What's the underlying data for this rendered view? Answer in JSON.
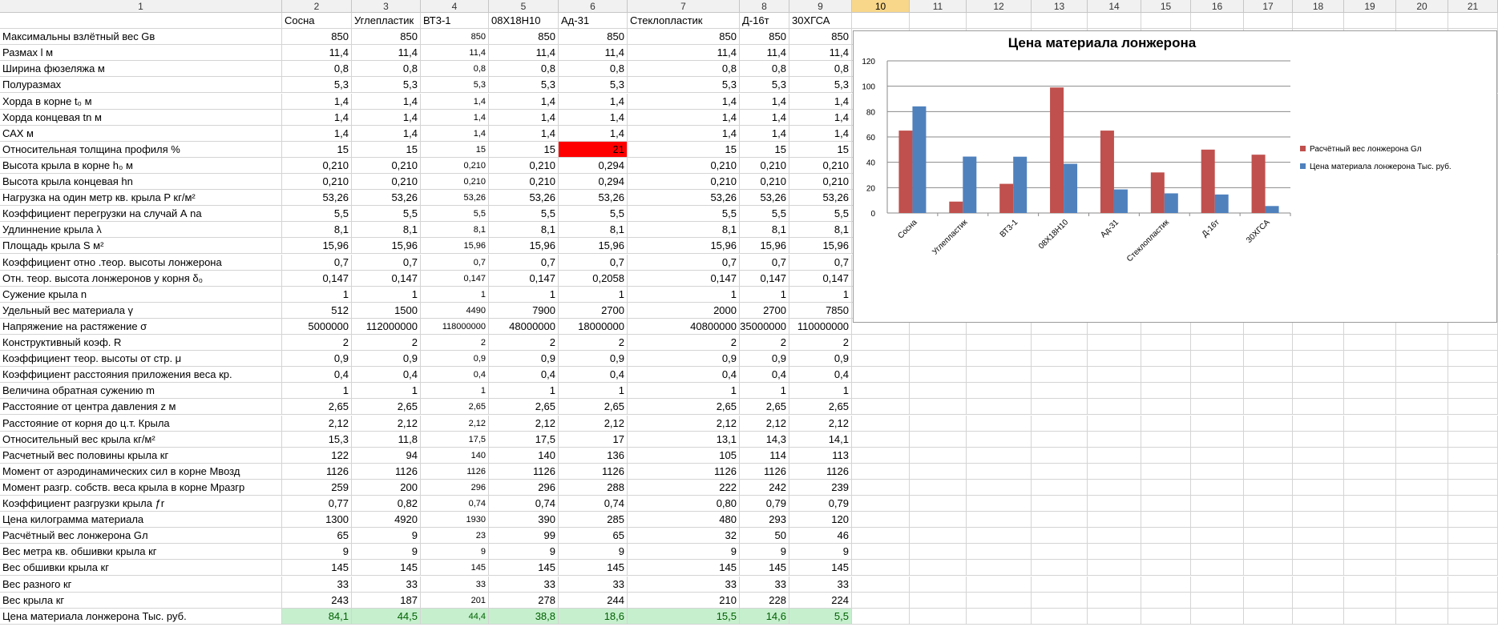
{
  "sheet": {
    "column_headers": [
      "1",
      "2",
      "3",
      "4",
      "5",
      "6",
      "7",
      "8",
      "9",
      "10",
      "11",
      "12",
      "13",
      "14",
      "15",
      "16",
      "17",
      "18",
      "19",
      "20",
      "21"
    ],
    "active_column": "10",
    "materials": [
      "Сосна",
      "Углепластик",
      "ВТ3-1",
      "08Х18Н10",
      "Ад-31",
      "Стеклопластик",
      "Д-16т",
      "30ХГСА"
    ],
    "rows": [
      {
        "label": "Максимальны взлётный вес Gв",
        "values": [
          "850",
          "850",
          "850",
          "850",
          "850",
          "850",
          "850",
          "850"
        ]
      },
      {
        "label": "Размах l м",
        "values": [
          "11,4",
          "11,4",
          "11,4",
          "11,4",
          "11,4",
          "11,4",
          "11,4",
          "11,4"
        ]
      },
      {
        "label": "Ширина фюзеляжа м",
        "values": [
          "0,8",
          "0,8",
          "0,8",
          "0,8",
          "0,8",
          "0,8",
          "0,8",
          "0,8"
        ]
      },
      {
        "label": "Полуразмах",
        "values": [
          "5,3",
          "5,3",
          "5,3",
          "5,3",
          "5,3",
          "5,3",
          "5,3",
          "5,3"
        ]
      },
      {
        "label": "Хорда в корне t₀ м",
        "values": [
          "1,4",
          "1,4",
          "1,4",
          "1,4",
          "1,4",
          "1,4",
          "1,4",
          "1,4"
        ]
      },
      {
        "label": "Хорда концевая tn м",
        "values": [
          "1,4",
          "1,4",
          "1,4",
          "1,4",
          "1,4",
          "1,4",
          "1,4",
          "1,4"
        ]
      },
      {
        "label": "САХ м",
        "values": [
          "1,4",
          "1,4",
          "1,4",
          "1,4",
          "1,4",
          "1,4",
          "1,4",
          "1,4"
        ]
      },
      {
        "label": "Относительная толщина профиля %",
        "values": [
          "15",
          "15",
          "15",
          "15",
          "21",
          "15",
          "15",
          "15"
        ]
      },
      {
        "label": "Высота крыла в корне h₀ м",
        "values": [
          "0,210",
          "0,210",
          "0,210",
          "0,210",
          "0,294",
          "0,210",
          "0,210",
          "0,210"
        ]
      },
      {
        "label": "Высота крыла концевая hn",
        "values": [
          "0,210",
          "0,210",
          "0,210",
          "0,210",
          "0,294",
          "0,210",
          "0,210",
          "0,210"
        ]
      },
      {
        "label": "Нагрузка на один метр кв. крыла P кг/м²",
        "values": [
          "53,26",
          "53,26",
          "53,26",
          "53,26",
          "53,26",
          "53,26",
          "53,26",
          "53,26"
        ]
      },
      {
        "label": "Коэффициент перегрузки на случай А nа",
        "values": [
          "5,5",
          "5,5",
          "5,5",
          "5,5",
          "5,5",
          "5,5",
          "5,5",
          "5,5"
        ]
      },
      {
        "label": "Удлиннение крыла λ",
        "values": [
          "8,1",
          "8,1",
          "8,1",
          "8,1",
          "8,1",
          "8,1",
          "8,1",
          "8,1"
        ]
      },
      {
        "label": "Площадь крыла S м²",
        "values": [
          "15,96",
          "15,96",
          "15,96",
          "15,96",
          "15,96",
          "15,96",
          "15,96",
          "15,96"
        ]
      },
      {
        "label": "Коэффициент отно .теор. высоты лонжерона",
        "values": [
          "0,7",
          "0,7",
          "0,7",
          "0,7",
          "0,7",
          "0,7",
          "0,7",
          "0,7"
        ]
      },
      {
        "label": "Отн. теор. высота лонжеронов у корня δ₀",
        "values": [
          "0,147",
          "0,147",
          "0,147",
          "0,147",
          "0,2058",
          "0,147",
          "0,147",
          "0,147"
        ]
      },
      {
        "label": "Сужение крыла n",
        "values": [
          "1",
          "1",
          "1",
          "1",
          "1",
          "1",
          "1",
          "1"
        ]
      },
      {
        "label": "Удельный вес материала γ",
        "values": [
          "512",
          "1500",
          "4490",
          "7900",
          "2700",
          "2000",
          "2700",
          "7850"
        ]
      },
      {
        "label": "Напряжение на растяжение σ",
        "values": [
          "5000000",
          "112000000",
          "118000000",
          "48000000",
          "18000000",
          "40800000",
          "35000000",
          "110000000"
        ]
      },
      {
        "label": "Конструктивный коэф. R",
        "values": [
          "2",
          "2",
          "2",
          "2",
          "2",
          "2",
          "2",
          "2"
        ]
      },
      {
        "label": "Коэффициент теор.  высоты  от стр. μ",
        "values": [
          "0,9",
          "0,9",
          "0,9",
          "0,9",
          "0,9",
          "0,9",
          "0,9",
          "0,9"
        ]
      },
      {
        "label": "Коэффициент расстояния приложения веса кр.",
        "values": [
          "0,4",
          "0,4",
          "0,4",
          "0,4",
          "0,4",
          "0,4",
          "0,4",
          "0,4"
        ]
      },
      {
        "label": "Величина обратная сужению m",
        "values": [
          "1",
          "1",
          "1",
          "1",
          "1",
          "1",
          "1",
          "1"
        ]
      },
      {
        "label": "Расстояние от центра давления z м",
        "values": [
          "2,65",
          "2,65",
          "2,65",
          "2,65",
          "2,65",
          "2,65",
          "2,65",
          "2,65"
        ]
      },
      {
        "label": "Расстояние от корня до ц.т. Крыла",
        "values": [
          "2,12",
          "2,12",
          "2,12",
          "2,12",
          "2,12",
          "2,12",
          "2,12",
          "2,12"
        ]
      },
      {
        "label": "Относительный вес крыла кг/м²",
        "values": [
          "15,3",
          "11,8",
          "17,5",
          "17,5",
          "17",
          "13,1",
          "14,3",
          "14,1"
        ]
      },
      {
        "label": "Расчетный вес половины крыла кг",
        "values": [
          "122",
          "94",
          "140",
          "140",
          "136",
          "105",
          "114",
          "113"
        ]
      },
      {
        "label": "Момент от аэродинамических сил в корне Mвозд",
        "values": [
          "1126",
          "1126",
          "1126",
          "1126",
          "1126",
          "1126",
          "1126",
          "1126"
        ]
      },
      {
        "label": "Момент разгр. собств. веса крыла в корне Mразгр",
        "values": [
          "259",
          "200",
          "296",
          "296",
          "288",
          "222",
          "242",
          "239"
        ]
      },
      {
        "label": "Коэффициент разгрузки крыла ƒr",
        "values": [
          "0,77",
          "0,82",
          "0,74",
          "0,74",
          "0,74",
          "0,80",
          "0,79",
          "0,79"
        ]
      },
      {
        "label": "Цена килограмма материала",
        "values": [
          "1300",
          "4920",
          "1930",
          "390",
          "285",
          "480",
          "293",
          "120"
        ]
      },
      {
        "label": "Расчётный вес лонжерона Gл",
        "values": [
          "65",
          "9",
          "23",
          "99",
          "65",
          "32",
          "50",
          "46"
        ]
      },
      {
        "label": "Вес метра кв. обшивки крыла кг",
        "values": [
          "9",
          "9",
          "9",
          "9",
          "9",
          "9",
          "9",
          "9"
        ]
      },
      {
        "label": "Вес обшивки крыла кг",
        "values": [
          "145",
          "145",
          "145",
          "145",
          "145",
          "145",
          "145",
          "145"
        ]
      },
      {
        "label": "Вес разного кг",
        "values": [
          "33",
          "33",
          "33",
          "33",
          "33",
          "33",
          "33",
          "33"
        ]
      },
      {
        "label": "Вес крыла кг",
        "values": [
          "243",
          "187",
          "201",
          "278",
          "244",
          "210",
          "228",
          "224"
        ]
      },
      {
        "label": "Цена материала лонжерона Тыс. руб.",
        "values": [
          "84,1",
          "44,5",
          "44,4",
          "38,8",
          "18,6",
          "15,5",
          "14,6",
          "5,5"
        ]
      }
    ],
    "highlight": {
      "red_cell": {
        "row": 7,
        "col": 4
      },
      "green_row": 36
    },
    "colors": {
      "red": "#ff0000",
      "green_fill": "#c6efce",
      "green_text": "#006100",
      "active_header": "#f8d78b"
    }
  },
  "chart_data": {
    "type": "bar",
    "title": "Цена материала лонжерона",
    "categories": [
      "Сосна",
      "Углепластик",
      "ВТ3-1",
      "08Х18Н10",
      "Ад-31",
      "Стеклопластик",
      "Д-16т",
      "30ХГСА"
    ],
    "series": [
      {
        "name": "Расчётный вес лонжерона Gл",
        "color": "#c0504d",
        "values": [
          65,
          9,
          23,
          99,
          65,
          32,
          50,
          46
        ]
      },
      {
        "name": "Цена материала лонжерона Тыс. руб.",
        "color": "#4f81bd",
        "values": [
          84.1,
          44.5,
          44.4,
          38.8,
          18.6,
          15.5,
          14.6,
          5.5
        ]
      }
    ],
    "ylim": [
      0,
      120
    ],
    "yticks": [
      0,
      20,
      40,
      60,
      80,
      100,
      120
    ],
    "grid": true,
    "legend": "right"
  }
}
